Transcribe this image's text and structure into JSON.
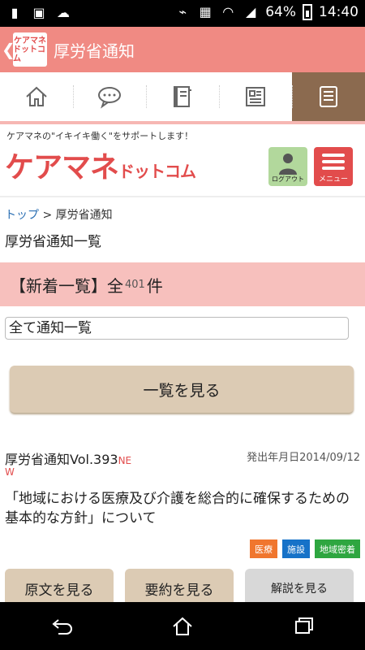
{
  "status_bar": {
    "battery": "64%",
    "time": "14:40"
  },
  "app_bar": {
    "back_glyph": "❮",
    "logo_line1": "ケアマネ",
    "logo_line2": "ドットコム",
    "title": "厚労省通知"
  },
  "tabs": [
    {
      "icon": "home-icon"
    },
    {
      "icon": "chat-icon"
    },
    {
      "icon": "book-icon"
    },
    {
      "icon": "document-icon"
    },
    {
      "icon": "list-icon",
      "active": true
    }
  ],
  "brand": {
    "tagline": "ケアマネの\"イキイキ働く\"をサポートします！",
    "wordmark_main": "ケアマネ",
    "wordmark_sub": "ドットコム",
    "logout_label": "ログアウト",
    "menu_label": "メニュー"
  },
  "breadcrumb": {
    "top": "トップ",
    "separator": ">",
    "current": "厚労省通知"
  },
  "page_title": "厚労省通知一覧",
  "new_list": {
    "prefix": "【新着一覧】全",
    "count": "401",
    "suffix": "件"
  },
  "filter": {
    "selected": "全て通知一覧"
  },
  "view_list_button": "一覧を見る",
  "notice": {
    "title": "厚労省通知Vol.393",
    "new_badge_1": "NE",
    "new_badge_2": "W",
    "date_label": "発出年月日2014/09/12",
    "body": "「地域における医療及び介護を総合的に確保するための基本的な方針」について",
    "tags": [
      "医療",
      "施設",
      "地域密着"
    ],
    "buttons": [
      "原文を見る",
      "要約を見る",
      "解説を見る"
    ]
  },
  "colors": {
    "app_bar": "#f08a83",
    "accent_red": "#e24c4c",
    "tab_active": "#8b6a4f",
    "new_bar": "#f7c0bd",
    "button_tan": "#dccbb4"
  }
}
